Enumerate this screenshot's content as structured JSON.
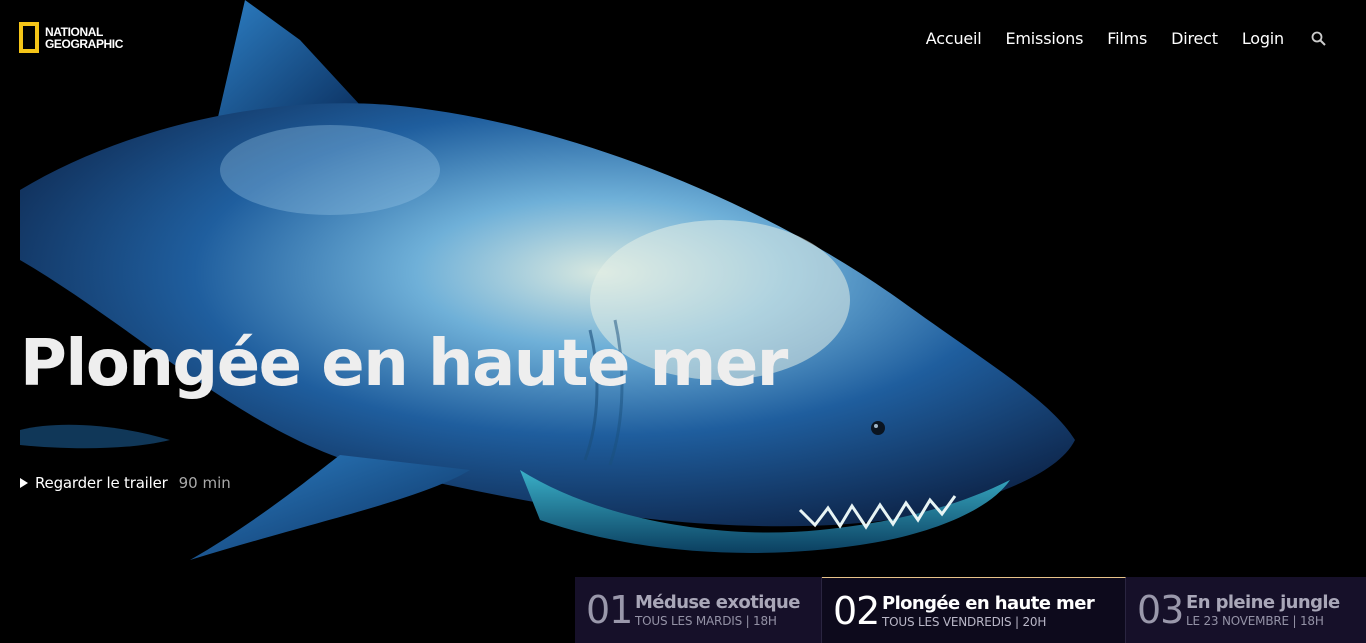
{
  "brand": {
    "line1": "NATIONAL",
    "line2": "GEOGRAPHIC",
    "accent_color": "#f5c518"
  },
  "nav": {
    "items": [
      {
        "label": "Accueil"
      },
      {
        "label": "Emissions"
      },
      {
        "label": "Films"
      },
      {
        "label": "Direct"
      },
      {
        "label": "Login"
      }
    ],
    "search_icon": "search-icon"
  },
  "hero": {
    "title": "Plongée en haute mer",
    "trailer_label": "Regarder le trailer",
    "duration": "90 min",
    "image": "shark"
  },
  "schedule": [
    {
      "number": "01",
      "title": "Méduse exotique",
      "when": "TOUS LES MARDIS | 18H",
      "active": false
    },
    {
      "number": "02",
      "title": "Plongée en haute mer",
      "when": "TOUS LES VENDREDIS | 20H",
      "active": true
    },
    {
      "number": "03",
      "title": "En pleine jungle",
      "when": "LE 23 NOVEMBRE | 18H",
      "active": false
    }
  ]
}
